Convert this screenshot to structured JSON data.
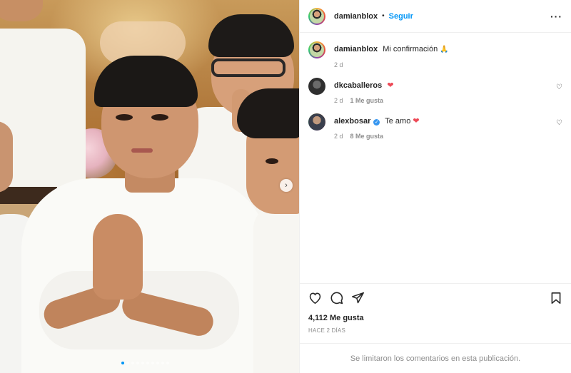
{
  "post": {
    "author": "damianblox",
    "follow_label": "Seguir",
    "separator": "•",
    "more_icon": "more-horizontal-icon",
    "caption": {
      "user": "damianblox",
      "text": "Mi confirmación",
      "emoji": "🙏",
      "time": "2 d"
    },
    "comments": [
      {
        "user": "dkcaballeros",
        "text": "",
        "emoji": "❤",
        "time": "2 d",
        "likes": "1 Me gusta",
        "verified": false
      },
      {
        "user": "alexbosar",
        "text": "Te amo",
        "emoji": "❤",
        "time": "2 d",
        "likes": "8 Me gusta",
        "verified": true
      }
    ],
    "likes_total": "4,112 Me gusta",
    "posted_ago": "HACE 2 DÍAS",
    "comments_disabled": "Se limitaron los comentarios en esta publicación.",
    "carousel": {
      "next_icon": "chevron-right-icon",
      "slide_count": 10,
      "active_slide": 1
    },
    "icons": [
      "heart-icon",
      "comment-icon",
      "share-icon",
      "bookmark-icon"
    ],
    "colors": {
      "link": "#0095f6",
      "heart": "#ed4956",
      "muted": "#8e8e8e",
      "verified": "#3897f0"
    }
  }
}
